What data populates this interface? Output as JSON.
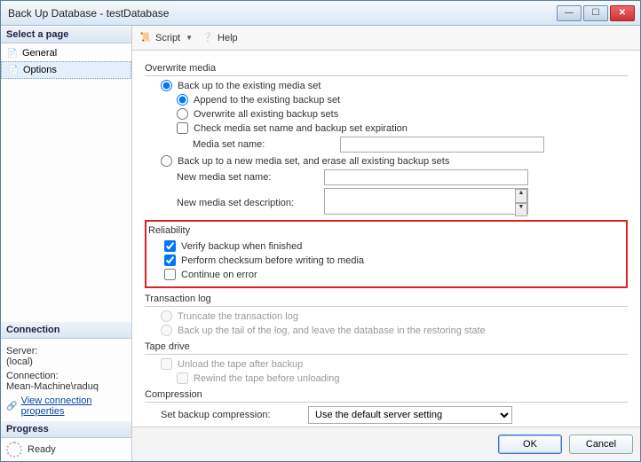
{
  "title": "Back Up Database - testDatabase",
  "sidebar": {
    "selectPage": "Select a page",
    "items": [
      {
        "icon": "📄",
        "label": "General"
      },
      {
        "icon": "📄",
        "label": "Options"
      }
    ],
    "connection": {
      "header": "Connection",
      "serverLbl": "Server:",
      "serverVal": "(local)",
      "connLbl": "Connection:",
      "connVal": "Mean-Machine\\raduq",
      "viewLink": "View connection properties"
    },
    "progress": {
      "header": "Progress",
      "ready": "Ready"
    }
  },
  "toolbar": {
    "script": "Script",
    "help": "Help"
  },
  "main": {
    "overwriteMedia": "Overwrite media",
    "backupExisting": "Back up to the existing media set",
    "appendExisting": "Append to the existing backup set",
    "overwriteAll": "Overwrite all existing backup sets",
    "checkMedia": "Check media set name and backup set expiration",
    "mediaSetName": "Media set name:",
    "backupNew": "Back up to a new media set, and erase all existing backup sets",
    "newMediaName": "New media set name:",
    "newMediaDesc": "New media set description:",
    "reliability": "Reliability",
    "verifyBackup": "Verify backup when finished",
    "performChecksum": "Perform checksum before writing to media",
    "continueError": "Continue on error",
    "transactionLog": "Transaction log",
    "truncateLog": "Truncate the transaction log",
    "backupTail": "Back up the tail of the log, and leave the database in the restoring state",
    "tapeDrive": "Tape drive",
    "unloadTape": "Unload the tape after backup",
    "rewindTape": "Rewind the tape before unloading",
    "compression": "Compression",
    "setCompression": "Set backup compression:",
    "compressionVal": "Use the default server setting"
  },
  "footer": {
    "ok": "OK",
    "cancel": "Cancel"
  }
}
